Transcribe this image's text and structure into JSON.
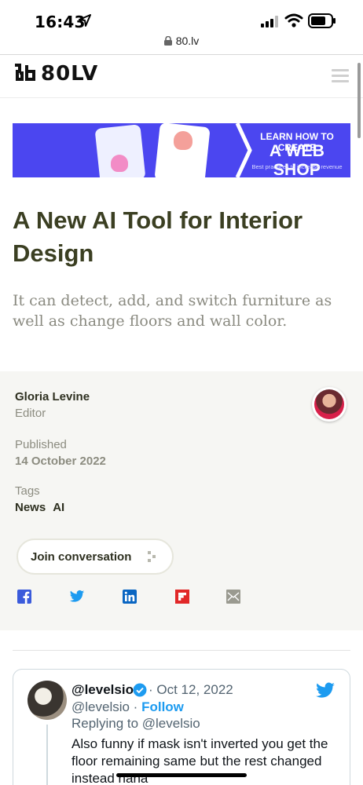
{
  "status_bar": {
    "time": "16:43"
  },
  "browser": {
    "url": "80.lv"
  },
  "site": {
    "logo_text": "80LV"
  },
  "banner": {
    "line1": "LEARN HOW TO CREATE",
    "line2": "A WEB SHOP",
    "line3": "Best practices to increase revenue",
    "bg_color": "#4b46f0"
  },
  "article": {
    "title": "A New AI Tool for Interior Design",
    "subtitle": "It can detect, add, and switch furniture as well as change floors and wall color."
  },
  "meta": {
    "author": "Gloria Levine",
    "role": "Editor",
    "published_label": "Published",
    "published_date": "14 October 2022",
    "tags_label": "Tags",
    "tags": [
      "News",
      "AI"
    ],
    "join_label": "Join conversation"
  },
  "share": [
    {
      "icon": "facebook-icon",
      "color": "#3b5bdb"
    },
    {
      "icon": "twitter-icon",
      "color": "#1d9bf0"
    },
    {
      "icon": "linkedin-icon",
      "color": "#0a66c2"
    },
    {
      "icon": "flipboard-icon",
      "color": "#e12828"
    },
    {
      "icon": "email-icon",
      "color": "#9a9a90"
    }
  ],
  "tweet": {
    "name": "@levelsio",
    "date": "· Oct 12, 2022",
    "handle": "@levelsio ·",
    "follow": "Follow",
    "reply": "Replying to @levelsio",
    "text": "Also funny if mask isn't inverted you get the floor remaining same but the rest changed instead haha"
  }
}
